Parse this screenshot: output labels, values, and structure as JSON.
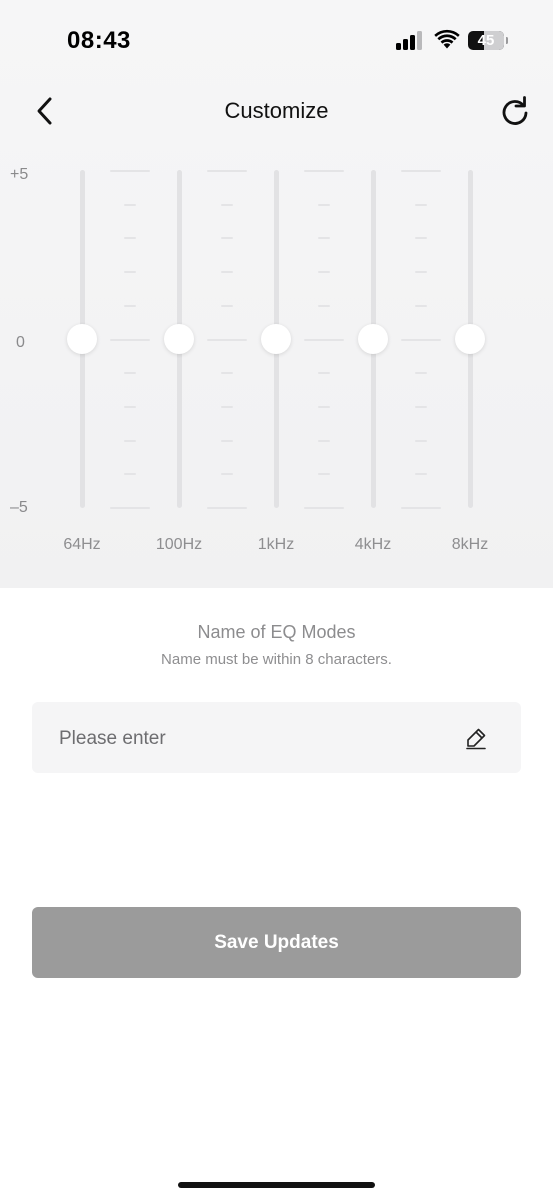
{
  "status_bar": {
    "time": "08:43",
    "battery_percent": "45",
    "signal_bars_active": 3,
    "signal_bars_total": 4
  },
  "nav": {
    "title": "Customize",
    "back_icon": "chevron-left-icon",
    "reset_icon": "refresh-icon"
  },
  "eq": {
    "scale_max_label": "+5",
    "scale_mid_label": "0",
    "scale_min_label": "–5",
    "range": [
      -5,
      5
    ],
    "bands": [
      {
        "label": "64Hz",
        "value": 0
      },
      {
        "label": "100Hz",
        "value": 0
      },
      {
        "label": "1kHz",
        "value": 0
      },
      {
        "label": "4kHz",
        "value": 0
      },
      {
        "label": "8kHz",
        "value": 0
      }
    ]
  },
  "name_section": {
    "title": "Name of EQ Modes",
    "hint": "Name must be within 8 characters.",
    "input_value": "",
    "input_placeholder": "Please enter",
    "edit_icon": "pencil-icon"
  },
  "save_button": {
    "label": "Save Updates",
    "color": "#9b9b9b"
  },
  "colors": {
    "eq_background": "#f3f3f4",
    "track": "#e2e2e4",
    "knob": "#ffffff"
  }
}
